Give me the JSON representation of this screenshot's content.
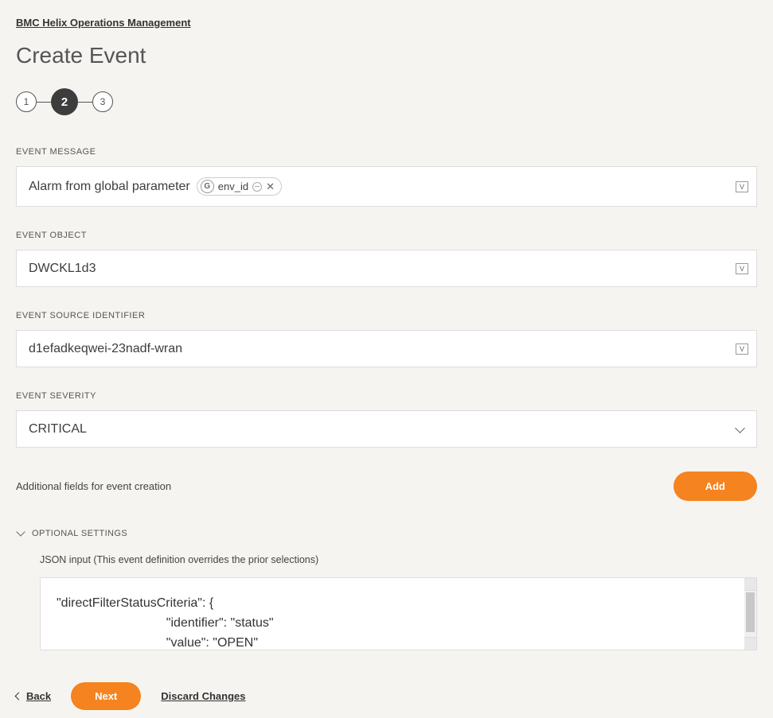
{
  "breadcrumb": {
    "text": "BMC Helix Operations Management"
  },
  "page_title": "Create Event",
  "stepper": {
    "steps": [
      "1",
      "2",
      "3"
    ],
    "active_index": 1
  },
  "fields": {
    "event_message": {
      "label": "EVENT MESSAGE",
      "prefix_text": "Alarm from global parameter",
      "chip_badge": "G",
      "chip_text": "env_id"
    },
    "event_object": {
      "label": "EVENT OBJECT",
      "value": "DWCKL1d3"
    },
    "event_source_identifier": {
      "label": "EVENT SOURCE IDENTIFIER",
      "value": "d1efadkeqwei-23nadf-wran"
    },
    "event_severity": {
      "label": "EVENT SEVERITY",
      "value": "CRITICAL"
    }
  },
  "variable_indicator": "V",
  "additional": {
    "label": "Additional fields for event creation",
    "add_button": "Add"
  },
  "optional": {
    "header": "OPTIONAL SETTINGS",
    "json_label": "JSON input (This event definition overrides the prior selections)",
    "json_content": "\"directFilterStatusCriteria\": {\n                               \"identifier\": \"status\"\n                               \"value\": \"OPEN\""
  },
  "footer": {
    "back": "Back",
    "next": "Next",
    "discard": "Discard Changes"
  }
}
